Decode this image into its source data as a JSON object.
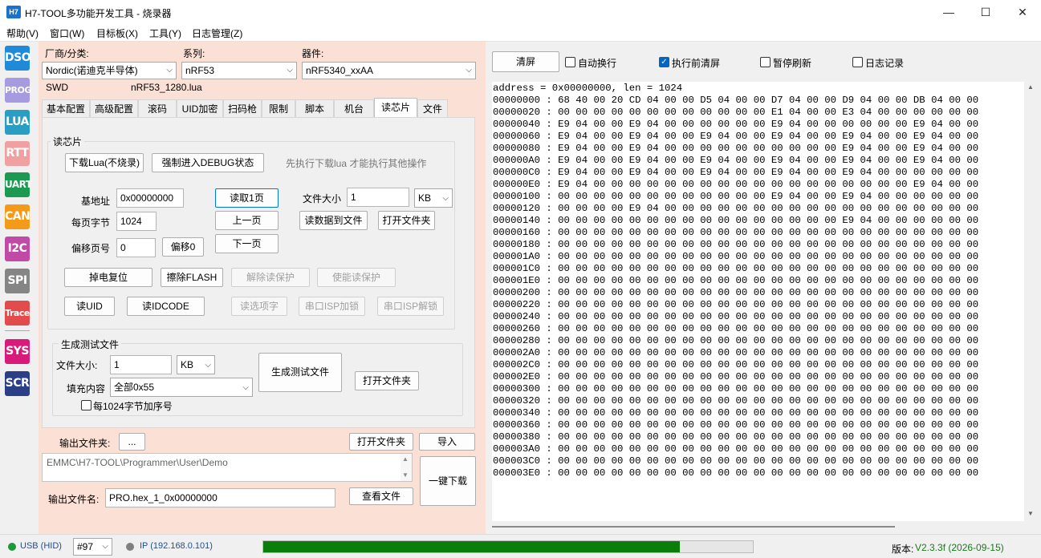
{
  "window": {
    "app_icon": "H7",
    "title": "H7-TOOL多功能开发工具 - 烧录器",
    "minimize": "—",
    "maximize": "☐",
    "close": "✕"
  },
  "menu": [
    "帮助(V)",
    "窗口(W)",
    "目标板(X)",
    "工具(Y)",
    "日志管理(Z)"
  ],
  "sidebar": [
    {
      "label": "DSO",
      "color": "#1f8ad8"
    },
    {
      "label": "PROG",
      "color": "#a69be0"
    },
    {
      "label": "LUA",
      "color": "#2a9ec2"
    },
    {
      "label": "RTT",
      "color": "#f0a0a0"
    },
    {
      "label": "UART",
      "color": "#1d9a52"
    },
    {
      "label": "CAN",
      "color": "#f39a18"
    },
    {
      "label": "I2C",
      "color": "#c04aa5"
    },
    {
      "label": "SPI",
      "color": "#858585"
    },
    {
      "label": "Trace",
      "color": "#e34c4c"
    },
    {
      "label": "SYS",
      "color": "#d81b7a"
    },
    {
      "label": "SCR",
      "color": "#2b3f86"
    }
  ],
  "device": {
    "vendor_label": "厂商/分类:",
    "vendor_value": "Nordic(诺迪克半导体)",
    "series_label": "系列:",
    "series_value": "nRF53",
    "part_label": "器件:",
    "part_value": "nRF5340_xxAA",
    "interface": "SWD",
    "lua_file": "nRF53_1280.lua"
  },
  "tabs": [
    "基本配置",
    "高级配置",
    "滚码",
    "UID加密",
    "扫码枪",
    "限制",
    "脚本",
    "机台",
    "读芯片",
    "文件"
  ],
  "read_chip": {
    "group_title": "读芯片",
    "download_lua": "下载Lua(不烧录)",
    "force_debug": "强制进入DEBUG状态",
    "hint": "先执行下载lua 才能执行其他操作",
    "base_addr_label": "基地址",
    "base_addr_value": "0x00000000",
    "page_bytes_label": "每页字节",
    "page_bytes_value": "1024",
    "offset_page_label": "偏移页号",
    "offset_page_value": "0",
    "offset0": "偏移0",
    "read_page": "读取1页",
    "prev_page": "上一页",
    "next_page": "下一页",
    "file_size_label": "文件大小",
    "file_size_value": "1",
    "file_size_unit": "KB",
    "read_to_file": "读数据到文件",
    "open_folder": "打开文件夹",
    "power_reset": "掉电复位",
    "erase_flash": "擦除FLASH",
    "unprotect": "解除读保护",
    "protect": "使能读保护",
    "read_uid": "读UID",
    "read_idcode": "读IDCODE",
    "read_option": "读选项字",
    "isp_lock": "串口ISP加锁",
    "isp_unlock": "串口ISP解锁"
  },
  "gen_test": {
    "group_title": "生成测试文件",
    "file_size_label": "文件大小:",
    "file_size_value": "1",
    "file_size_unit": "KB",
    "fill_label": "填充内容",
    "fill_value": "全部0x55",
    "gen_button": "生成测试文件",
    "open_folder": "打开文件夹",
    "seq_label": "每1024字节加序号"
  },
  "output": {
    "folder_label": "输出文件夹:",
    "browse": "...",
    "open_folder": "打开文件夹",
    "import": "导入",
    "path": "EMMC\\H7-TOOL\\Programmer\\User\\Demo",
    "one_click": "一键下载",
    "name_label": "输出文件名:",
    "name_value": "PRO.hex_1_0x00000000",
    "view_file": "查看文件"
  },
  "right_toolbar": {
    "clear": "清屏",
    "auto_wrap": "自动换行",
    "clear_before": "执行前清屏",
    "pause_refresh": "暂停刷新",
    "log_record": "日志记录"
  },
  "hex": [
    "address = 0x00000000, len = 1024",
    "00000000 : 68 40 00 20 CD 04 00 00 D5 04 00 00 D7 04 00 00 D9 04 00 00 DB 04 00 00",
    "00000020 : 00 00 00 00 00 00 00 00 00 00 00 00 E1 04 00 00 E3 04 00 00 00 00 00 00",
    "00000040 : E9 04 00 00 E9 04 00 00 00 00 00 00 E9 04 00 00 00 00 00 00 E9 04 00 00",
    "00000060 : E9 04 00 00 E9 04 00 00 E9 04 00 00 E9 04 00 00 E9 04 00 00 E9 04 00 00",
    "00000080 : E9 04 00 00 E9 04 00 00 00 00 00 00 00 00 00 00 E9 04 00 00 E9 04 00 00",
    "000000A0 : E9 04 00 00 E9 04 00 00 E9 04 00 00 E9 04 00 00 E9 04 00 00 E9 04 00 00",
    "000000C0 : E9 04 00 00 E9 04 00 00 E9 04 00 00 E9 04 00 00 E9 04 00 00 00 00 00 00",
    "000000E0 : E9 04 00 00 00 00 00 00 00 00 00 00 00 00 00 00 00 00 00 00 E9 04 00 00",
    "00000100 : 00 00 00 00 00 00 00 00 00 00 00 00 E9 04 00 00 E9 04 00 00 00 00 00 00",
    "00000120 : 00 00 00 00 E9 04 00 00 00 00 00 00 00 00 00 00 00 00 00 00 00 00 00 00",
    "00000140 : 00 00 00 00 00 00 00 00 00 00 00 00 00 00 00 00 E9 04 00 00 00 00 00 00",
    "00000160 : 00 00 00 00 00 00 00 00 00 00 00 00 00 00 00 00 00 00 00 00 00 00 00 00",
    "00000180 : 00 00 00 00 00 00 00 00 00 00 00 00 00 00 00 00 00 00 00 00 00 00 00 00",
    "000001A0 : 00 00 00 00 00 00 00 00 00 00 00 00 00 00 00 00 00 00 00 00 00 00 00 00",
    "000001C0 : 00 00 00 00 00 00 00 00 00 00 00 00 00 00 00 00 00 00 00 00 00 00 00 00",
    "000001E0 : 00 00 00 00 00 00 00 00 00 00 00 00 00 00 00 00 00 00 00 00 00 00 00 00",
    "00000200 : 00 00 00 00 00 00 00 00 00 00 00 00 00 00 00 00 00 00 00 00 00 00 00 00",
    "00000220 : 00 00 00 00 00 00 00 00 00 00 00 00 00 00 00 00 00 00 00 00 00 00 00 00",
    "00000240 : 00 00 00 00 00 00 00 00 00 00 00 00 00 00 00 00 00 00 00 00 00 00 00 00",
    "00000260 : 00 00 00 00 00 00 00 00 00 00 00 00 00 00 00 00 00 00 00 00 00 00 00 00",
    "00000280 : 00 00 00 00 00 00 00 00 00 00 00 00 00 00 00 00 00 00 00 00 00 00 00 00",
    "000002A0 : 00 00 00 00 00 00 00 00 00 00 00 00 00 00 00 00 00 00 00 00 00 00 00 00",
    "000002C0 : 00 00 00 00 00 00 00 00 00 00 00 00 00 00 00 00 00 00 00 00 00 00 00 00",
    "000002E0 : 00 00 00 00 00 00 00 00 00 00 00 00 00 00 00 00 00 00 00 00 00 00 00 00",
    "00000300 : 00 00 00 00 00 00 00 00 00 00 00 00 00 00 00 00 00 00 00 00 00 00 00 00",
    "00000320 : 00 00 00 00 00 00 00 00 00 00 00 00 00 00 00 00 00 00 00 00 00 00 00 00",
    "00000340 : 00 00 00 00 00 00 00 00 00 00 00 00 00 00 00 00 00 00 00 00 00 00 00 00",
    "00000360 : 00 00 00 00 00 00 00 00 00 00 00 00 00 00 00 00 00 00 00 00 00 00 00 00",
    "00000380 : 00 00 00 00 00 00 00 00 00 00 00 00 00 00 00 00 00 00 00 00 00 00 00 00",
    "000003A0 : 00 00 00 00 00 00 00 00 00 00 00 00 00 00 00 00 00 00 00 00 00 00 00 00",
    "000003C0 : 00 00 00 00 00 00 00 00 00 00 00 00 00 00 00 00 00 00 00 00 00 00 00 00",
    "000003E0 : 00 00 00 00 00 00 00 00 00 00 00 00 00 00 00 00 00 00 00 00 00 00 00 00"
  ],
  "status": {
    "usb": "USB (HID)",
    "usb_color": "#1a9a3a",
    "device_no": "#97",
    "ip": "IP (192.168.0.101)",
    "ip_color": "#808080",
    "progress": 0.85,
    "progress_color": "#0a7d0a",
    "version_label": "版本:",
    "version_value": "V2.3.3f (2026-09-15)",
    "version_color": "#1a7a1a"
  },
  "icons": {
    "chevron": "chevron-down-icon",
    "up": "scroll-up-icon",
    "down": "scroll-down-icon"
  }
}
